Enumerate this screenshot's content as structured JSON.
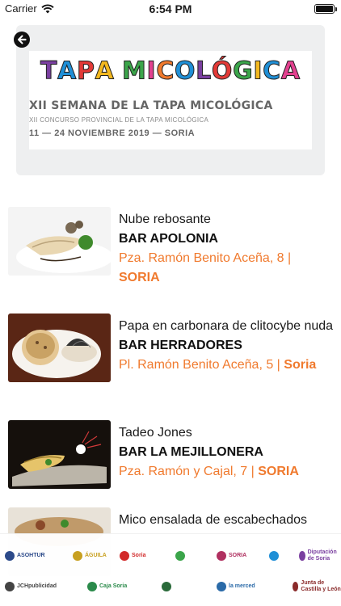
{
  "status_bar": {
    "carrier": "Carrier",
    "time": "6:54 PM"
  },
  "header": {
    "banner": {
      "title": "TAPA MICOLÓGICA",
      "title_colors": [
        "#7a3fa0",
        "#1f8fd6",
        "#e23a37",
        "#f3b81f",
        "#3ba54a",
        "#e2418f",
        "#f07a2e",
        "#1f8fd6",
        "#7a3fa0",
        "#e23a37",
        "#3ba54a",
        "#f3b81f",
        "#1f8fd6",
        "#e2418f",
        "#f07a2e"
      ],
      "subtitle": "XII SEMANA DE LA TAPA MICOLÓGICA",
      "subtitle2": "XII CONCURSO PROVINCIAL DE LA TAPA MICOLÓGICA",
      "dates": "11 — 24 NOVIEMBRE 2019 — SORIA"
    }
  },
  "items": [
    {
      "name": "Nube rebosante",
      "bar": "BAR APOLONIA",
      "address": "Pza. Ramón Benito Aceña, 8 |",
      "city": "SORIA",
      "thumb_bg": "#f2f2f2"
    },
    {
      "name": "Papa en carbonara de clitocybe nuda",
      "bar": "BAR HERRADORES",
      "address": "Pl. Ramón Benito Aceña, 5 |",
      "city": "Soria",
      "thumb_bg": "#5a2a18"
    },
    {
      "name": "Tadeo Jones",
      "bar": "BAR LA MEJILLONERA",
      "address": "Pza. Ramón y Cajal, 7 |",
      "city": "SORIA",
      "thumb_bg": "#1a1410"
    },
    {
      "name": "Mico ensalada de escabechados",
      "bar": "",
      "address": "",
      "city": "",
      "thumb_bg": "#d8cfc4"
    }
  ],
  "sponsors": {
    "logos": [
      {
        "label": "ASOHTUR",
        "color": "#2c4a8a"
      },
      {
        "label": "ÁGUILA",
        "color": "#c8a020"
      },
      {
        "label": "Soria",
        "color": "#d22a2a"
      },
      {
        "label": "",
        "color": "#3ba54a"
      },
      {
        "label": "SORIA",
        "color": "#b03060"
      },
      {
        "label": "",
        "color": "#1f8fd6"
      },
      {
        "label": "Diputación de Soria",
        "color": "#7a3fa0"
      },
      {
        "label": "JCHpublicidad",
        "color": "#444444"
      },
      {
        "label": "Caja Soria",
        "color": "#2a8a4a"
      },
      {
        "label": "",
        "color": "#2a6a3a"
      },
      {
        "label": "la merced",
        "color": "#2a6aa8"
      },
      {
        "label": "Junta de Castilla y León",
        "color": "#8a2a2a"
      }
    ]
  }
}
